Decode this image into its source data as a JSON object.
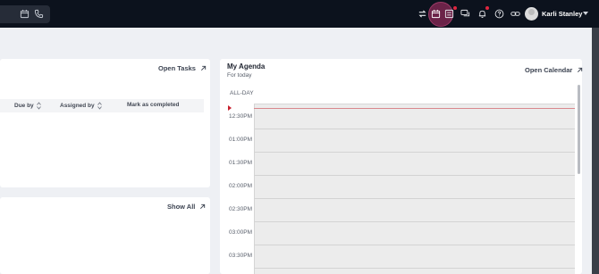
{
  "topbar": {
    "user_name": "Karli Stanley",
    "icons": [
      "calendar-icon",
      "phone-icon",
      "transfer-icon",
      "calendar-icon",
      "list-icon",
      "chat-icon",
      "bell-icon",
      "help-icon",
      "link-icon",
      "avatar",
      "chevron-down-icon"
    ]
  },
  "tasks": {
    "open_tasks_label": "Open Tasks",
    "columns": {
      "due_by": "Due by",
      "assigned_by": "Assigned by",
      "mark_completed": "Mark as completed"
    }
  },
  "lower_card": {
    "show_all_label": "Show All"
  },
  "agenda": {
    "title": "My Agenda",
    "subtitle": "For today",
    "open_calendar_label": "Open Calendar",
    "all_day_label": "ALL-DAY",
    "time_slots": [
      "12:30PM",
      "01:00PM",
      "01:30PM",
      "02:00PM",
      "02:30PM",
      "03:00PM",
      "03:30PM"
    ]
  },
  "colors": {
    "topbar_bg": "#0c121d",
    "notification_dot": "#e0263f",
    "now_indicator": "#c7202e"
  }
}
